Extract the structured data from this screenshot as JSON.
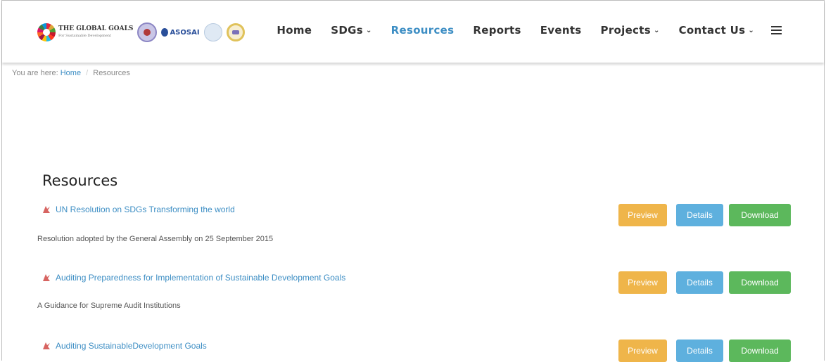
{
  "logos": {
    "goals_title": "THE GLOBAL GOALS",
    "goals_subtitle": "For Sustainable Development",
    "asosai_label": "ASOSAI"
  },
  "nav": {
    "home": "Home",
    "sdgs": "SDGs",
    "resources": "Resources",
    "reports": "Reports",
    "events": "Events",
    "projects": "Projects",
    "contact": "Contact Us",
    "chevron": "⌄",
    "active_color": "#3d8ec4"
  },
  "breadcrumb": {
    "prefix": "You are here:",
    "home": "Home",
    "separator": "/",
    "current": "Resources"
  },
  "page_title": "Resources",
  "buttons": {
    "preview": "Preview",
    "details": "Details",
    "download": "Download",
    "colors": {
      "preview": "#efb54a",
      "details": "#5eb0de",
      "download": "#5cb85c"
    }
  },
  "resources": [
    {
      "title": "UN Resolution on SDGs Transforming the world",
      "description": "Resolution adopted by the General Assembly on 25 September 2015",
      "icon": "pdf-icon"
    },
    {
      "title": "Auditing Preparedness for Implementation of Sustainable Development Goals",
      "description": "A Guidance for Supreme Audit Institutions",
      "icon": "pdf-icon"
    },
    {
      "title": "Auditing SustainableDevelopment Goals",
      "description": "",
      "icon": "pdf-icon"
    }
  ]
}
